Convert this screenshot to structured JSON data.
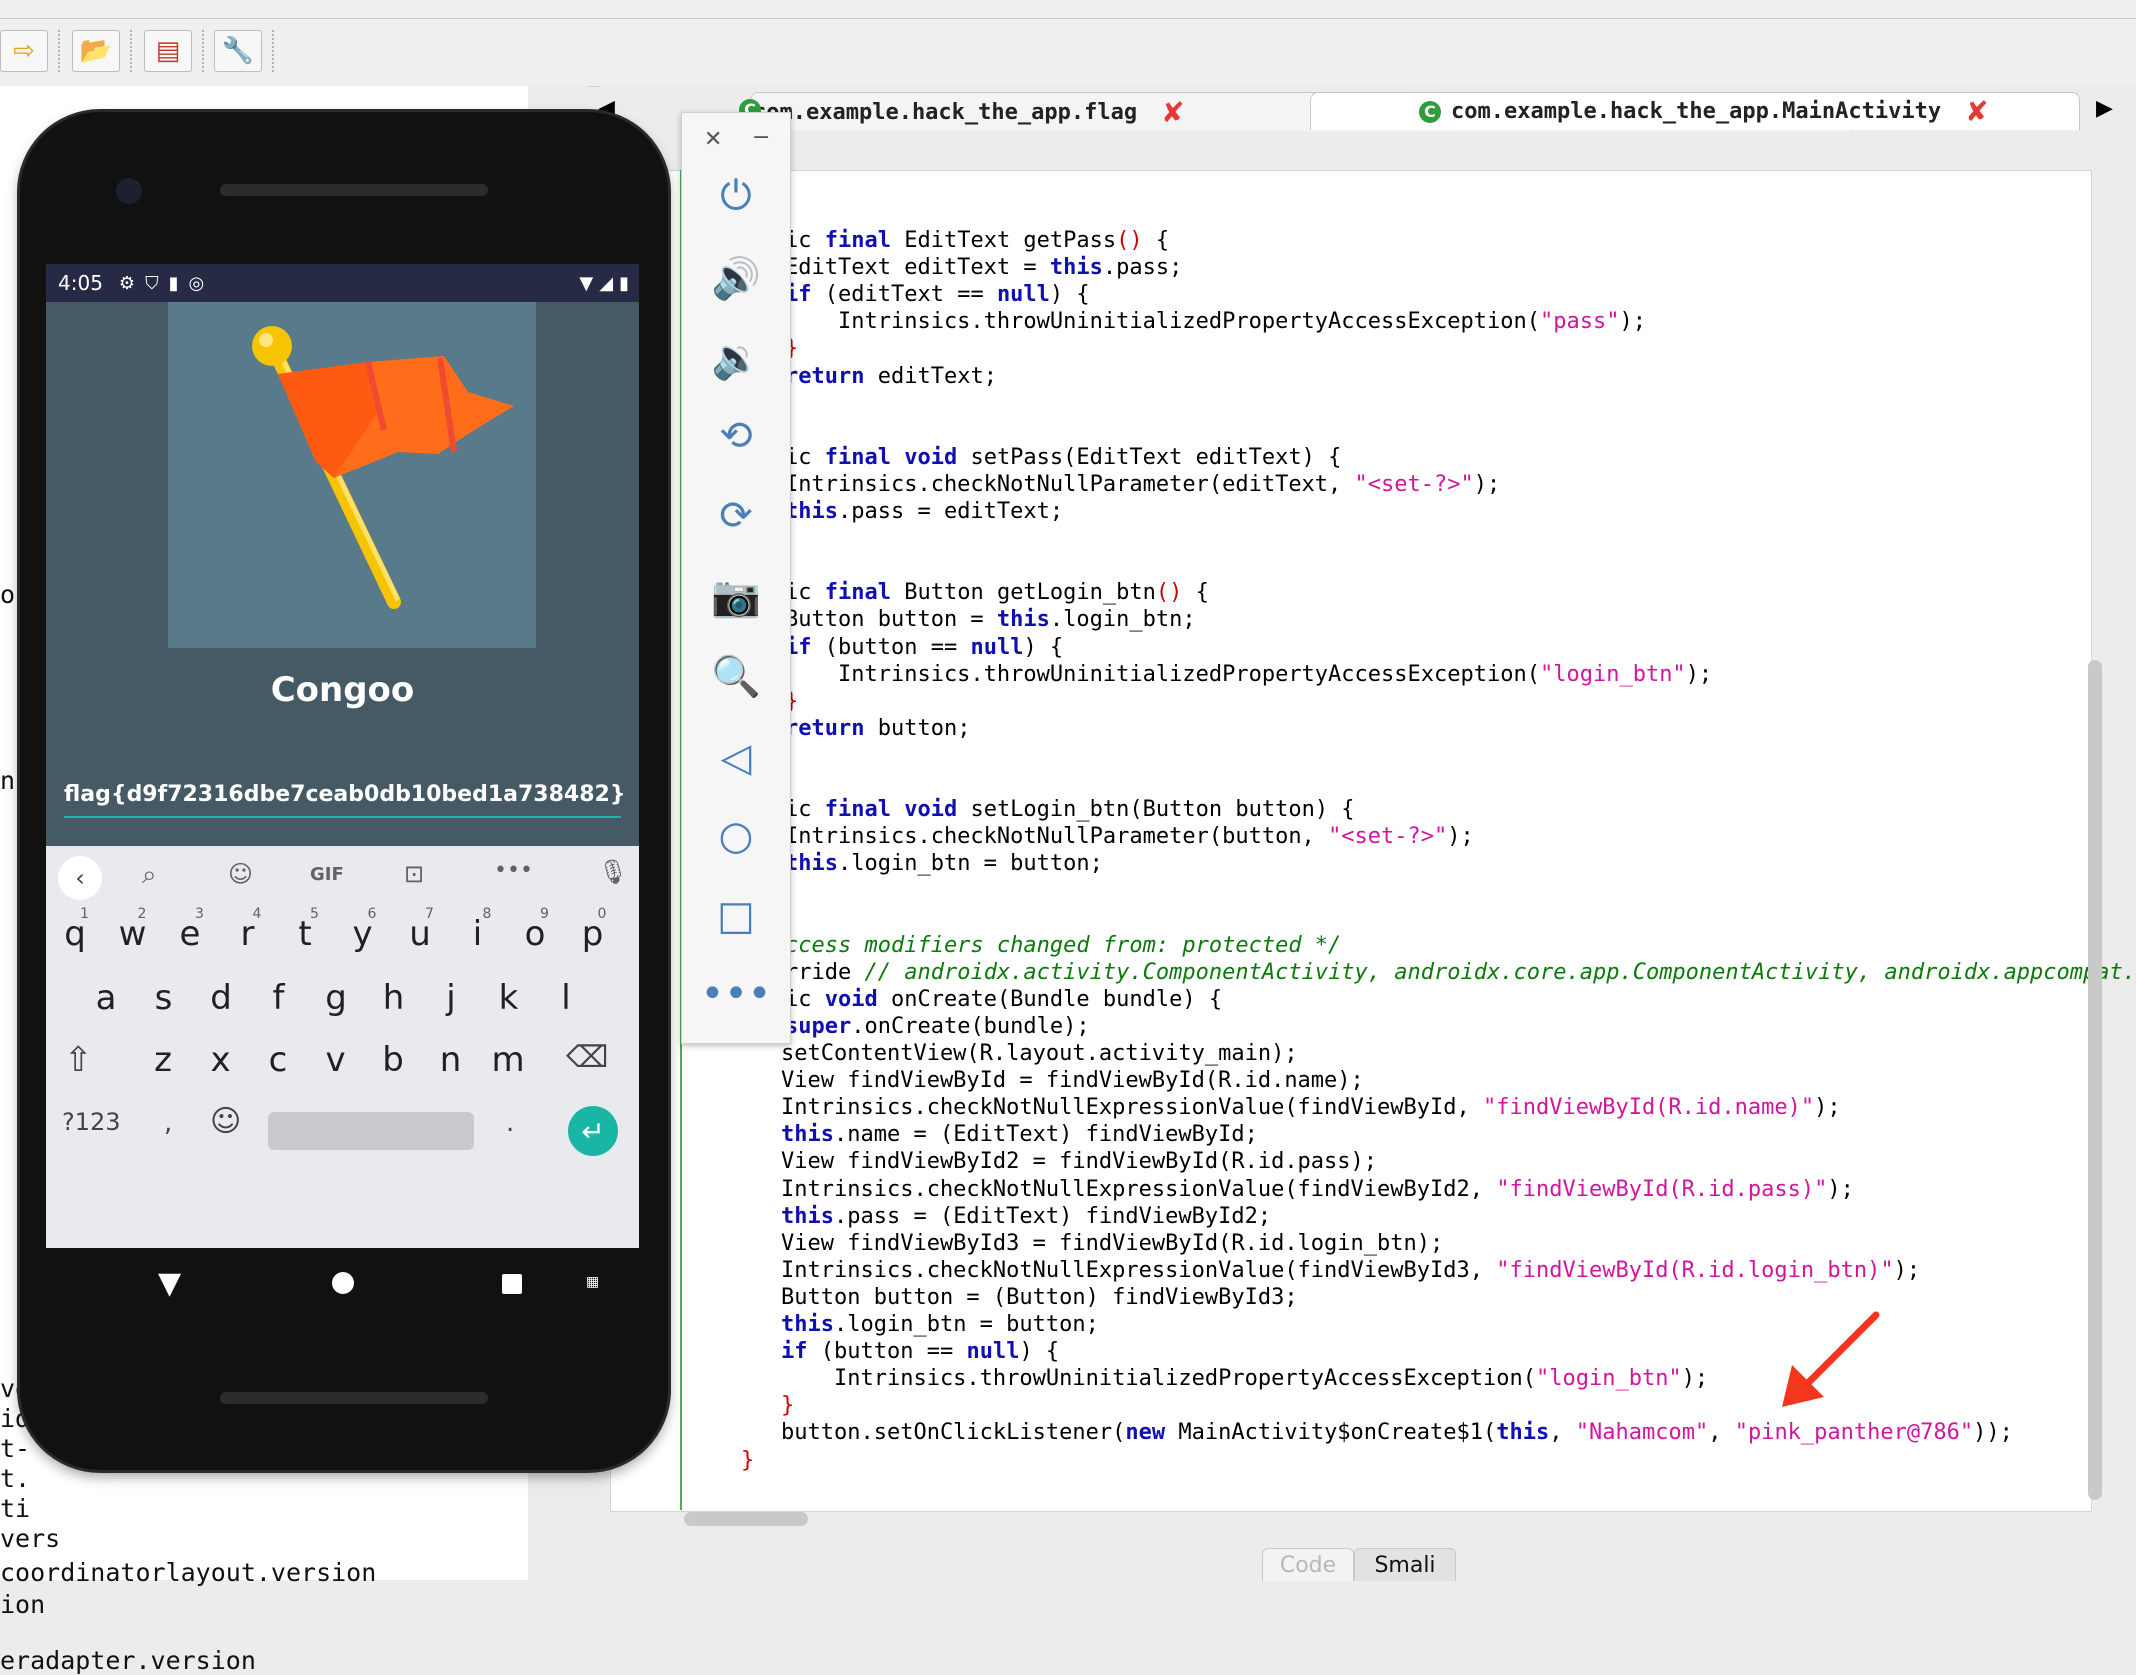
{
  "editor": {
    "tabs": [
      {
        "label": "com.example.hack_the_app.flag",
        "icon": "class-icon"
      },
      {
        "label": "com.example.hack_the_app.MainActivity",
        "icon": "class-icon"
      }
    ],
    "code_lines": [
      {
        "parts": [
          [
            "ic ",
            ""
          ],
          [
            "final",
            "kw"
          ],
          [
            " EditText getPass",
            ""
          ],
          [
            "()",
            "red"
          ],
          [
            " {",
            ""
          ]
        ]
      },
      {
        "parts": [
          [
            "EditText editText = ",
            ""
          ],
          [
            "this",
            "kw"
          ],
          [
            ".pass;",
            ""
          ]
        ]
      },
      {
        "parts": [
          [
            "if",
            "kw"
          ],
          [
            " (editText == ",
            ""
          ],
          [
            "null",
            "kw"
          ],
          [
            ") {",
            ""
          ]
        ]
      },
      {
        "parts": [
          [
            "    Intrinsics.throwUninitializedPropertyAccessException(",
            ""
          ],
          [
            "\"pass\"",
            "str"
          ],
          [
            ");",
            ""
          ]
        ]
      },
      {
        "parts": [
          [
            "}",
            "red"
          ]
        ]
      },
      {
        "parts": [
          [
            "return",
            "kw"
          ],
          [
            " editText;",
            ""
          ]
        ]
      },
      {
        "parts": [
          [
            "",
            ""
          ]
        ]
      },
      {
        "parts": [
          [
            "",
            ""
          ]
        ]
      },
      {
        "parts": [
          [
            "ic ",
            ""
          ],
          [
            "final void",
            "kw"
          ],
          [
            " setPass(EditText editText) {",
            ""
          ]
        ]
      },
      {
        "parts": [
          [
            "Intrinsics.checkNotNullParameter(editText, ",
            ""
          ],
          [
            "\"<set-?>\"",
            "str"
          ],
          [
            ");",
            ""
          ]
        ]
      },
      {
        "parts": [
          [
            "this",
            "kw"
          ],
          [
            ".pass = editText;",
            ""
          ]
        ]
      },
      {
        "parts": [
          [
            "",
            ""
          ]
        ]
      },
      {
        "parts": [
          [
            "",
            ""
          ]
        ]
      },
      {
        "parts": [
          [
            "ic ",
            ""
          ],
          [
            "final",
            "kw"
          ],
          [
            " Button getLogin_btn",
            ""
          ],
          [
            "()",
            "red"
          ],
          [
            " {",
            ""
          ]
        ]
      },
      {
        "parts": [
          [
            "Button button = ",
            ""
          ],
          [
            "this",
            "kw"
          ],
          [
            ".login_btn;",
            ""
          ]
        ]
      },
      {
        "parts": [
          [
            "if",
            "kw"
          ],
          [
            " (button == ",
            ""
          ],
          [
            "null",
            "kw"
          ],
          [
            ") {",
            ""
          ]
        ]
      },
      {
        "parts": [
          [
            "    Intrinsics.throwUninitializedPropertyAccessException(",
            ""
          ],
          [
            "\"login_btn\"",
            "str"
          ],
          [
            ");",
            ""
          ]
        ]
      },
      {
        "parts": [
          [
            "}",
            "red"
          ]
        ]
      },
      {
        "parts": [
          [
            "return",
            "kw"
          ],
          [
            " button;",
            ""
          ]
        ]
      },
      {
        "parts": [
          [
            "",
            ""
          ]
        ]
      },
      {
        "parts": [
          [
            "",
            ""
          ]
        ]
      },
      {
        "parts": [
          [
            "ic ",
            ""
          ],
          [
            "final void",
            "kw"
          ],
          [
            " setLogin_btn(Button button) {",
            ""
          ]
        ]
      },
      {
        "parts": [
          [
            "Intrinsics.checkNotNullParameter(button, ",
            ""
          ],
          [
            "\"<set-?>\"",
            "str"
          ],
          [
            ");",
            ""
          ]
        ]
      },
      {
        "parts": [
          [
            "this",
            "kw"
          ],
          [
            ".login_btn = button;",
            ""
          ]
        ]
      },
      {
        "parts": [
          [
            "",
            ""
          ]
        ]
      },
      {
        "parts": [
          [
            "",
            ""
          ]
        ]
      },
      {
        "parts": [
          [
            "ccess modifiers changed from: protected */",
            "cm"
          ]
        ]
      },
      {
        "parts": [
          [
            "rride ",
            ""
          ],
          [
            "// androidx.activity.ComponentActivity, androidx.core.app.ComponentActivity, androidx.appcompat.a",
            "cm"
          ]
        ]
      },
      {
        "parts": [
          [
            "ic ",
            ""
          ],
          [
            "void",
            "kw"
          ],
          [
            " onCreate(Bundle bundle) {",
            ""
          ]
        ]
      },
      {
        "parts": [
          [
            "super",
            "kw"
          ],
          [
            ".onCreate(bundle);",
            ""
          ]
        ]
      },
      {
        "parts": [
          [
            "setContentView(R.layout.activity_main);",
            ""
          ]
        ]
      },
      {
        "parts": [
          [
            "View findViewById = findViewById(R.id.name);",
            ""
          ]
        ]
      },
      {
        "parts": [
          [
            "Intrinsics.checkNotNullExpressionValue(findViewById, ",
            ""
          ],
          [
            "\"findViewById(R.id.name)\"",
            "str"
          ],
          [
            ");",
            ""
          ]
        ]
      },
      {
        "parts": [
          [
            "this",
            "kw"
          ],
          [
            ".name = (EditText) findViewById;",
            ""
          ]
        ]
      },
      {
        "parts": [
          [
            "View findViewById2 = findViewById(R.id.pass);",
            ""
          ]
        ]
      },
      {
        "parts": [
          [
            "Intrinsics.checkNotNullExpressionValue(findViewById2, ",
            ""
          ],
          [
            "\"findViewById(R.id.pass)\"",
            "str"
          ],
          [
            ");",
            ""
          ]
        ]
      },
      {
        "parts": [
          [
            "this",
            "kw"
          ],
          [
            ".pass = (EditText) findViewById2;",
            ""
          ]
        ]
      },
      {
        "parts": [
          [
            "View findViewById3 = findViewById(R.id.login_btn);",
            ""
          ]
        ]
      },
      {
        "parts": [
          [
            "Intrinsics.checkNotNullExpressionValue(findViewById3, ",
            ""
          ],
          [
            "\"findViewById(R.id.login_btn)\"",
            "str"
          ],
          [
            ");",
            ""
          ]
        ]
      },
      {
        "parts": [
          [
            "Button button = (Button) findViewById3;",
            ""
          ]
        ]
      },
      {
        "parts": [
          [
            "this",
            "kw"
          ],
          [
            ".login_btn = button;",
            ""
          ]
        ]
      },
      {
        "parts": [
          [
            "if",
            "kw"
          ],
          [
            " (button == ",
            ""
          ],
          [
            "null",
            "kw"
          ],
          [
            ") {",
            ""
          ]
        ]
      },
      {
        "parts": [
          [
            "    Intrinsics.throwUninitializedPropertyAccessException(",
            ""
          ],
          [
            "\"login_btn\"",
            "str"
          ],
          [
            ");",
            ""
          ]
        ]
      },
      {
        "parts": [
          [
            "}",
            "red"
          ]
        ]
      },
      {
        "parts": [
          [
            "button.setOnClickListener(",
            ""
          ],
          [
            "new",
            "kw"
          ],
          [
            " MainActivity$onCreate$1(",
            ""
          ],
          [
            "this",
            "kw"
          ],
          [
            ", ",
            ""
          ],
          [
            "\"Nahamcom\"",
            "str"
          ],
          [
            ", ",
            ""
          ],
          [
            "\"pink_panther@786\"",
            "str"
          ],
          [
            "));",
            ""
          ]
        ]
      },
      {
        "parts": [
          [
            "}",
            "red"
          ]
        ]
      }
    ],
    "bottom_tabs": [
      "Code",
      "Smali"
    ]
  },
  "left_panel": {
    "lines": [
      "ve",
      "id",
      "t-",
      "t.",
      "ti",
      "vers",
      "coordinatorlayout.version",
      "ion",
      "eradapter.version"
    ],
    "fragments": [
      "oi",
      "n("
    ]
  },
  "phone": {
    "status_time": "4:05",
    "app_title": "Congoo",
    "flag_text": "flag{d9f72316dbe7ceab0db10bed1a738482}",
    "keyboard": {
      "row1": [
        "q",
        "w",
        "e",
        "r",
        "t",
        "y",
        "u",
        "i",
        "o",
        "p"
      ],
      "row1_nums": [
        "1",
        "2",
        "3",
        "4",
        "5",
        "6",
        "7",
        "8",
        "9",
        "0"
      ],
      "row2": [
        "a",
        "s",
        "d",
        "f",
        "g",
        "h",
        "j",
        "k",
        "l"
      ],
      "row3": [
        "z",
        "x",
        "c",
        "v",
        "b",
        "n",
        "m"
      ],
      "symbols_key": "?123",
      "comma": ",",
      "period": ".",
      "gif_label": "GIF"
    }
  },
  "colors": {
    "accent_green": "#4caf50",
    "keyword_blue": "#1010b0",
    "string_magenta": "#d1159c",
    "arrow_red": "#f4361f"
  }
}
